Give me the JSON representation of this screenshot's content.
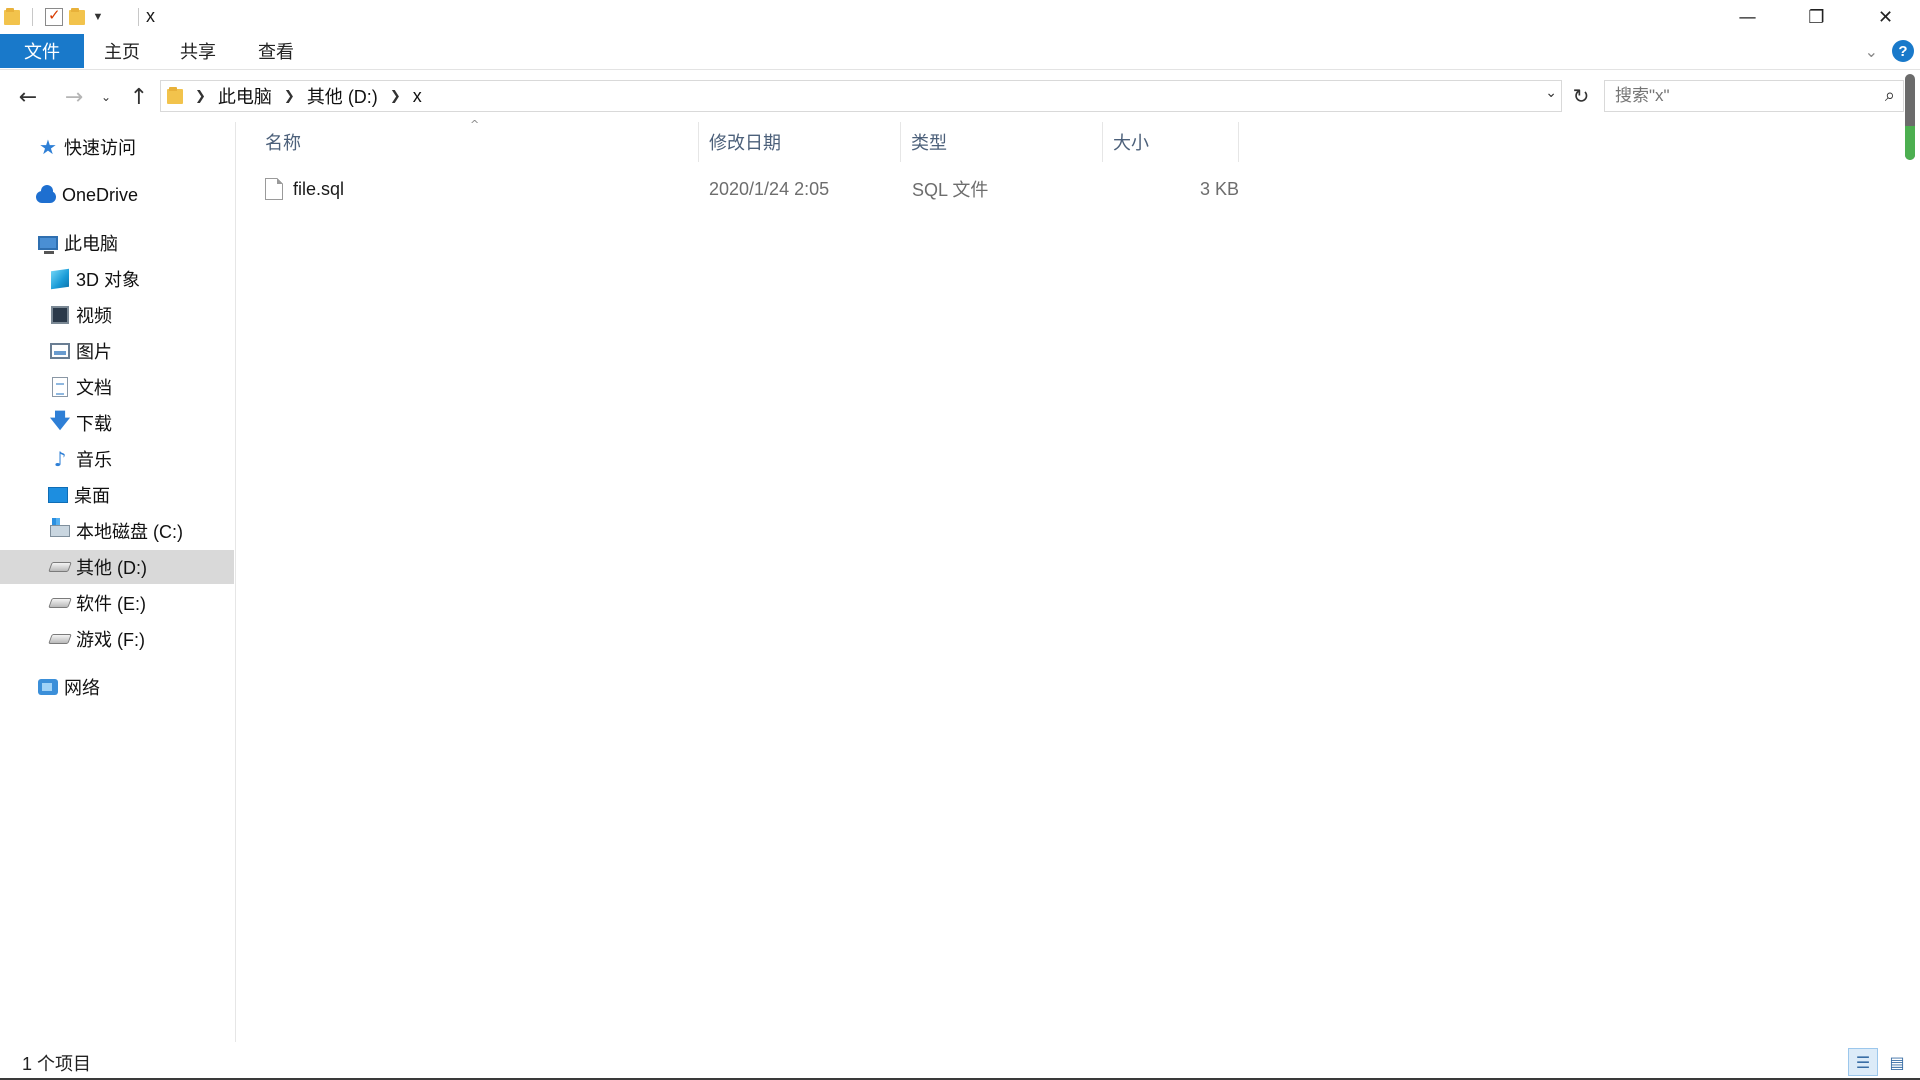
{
  "window": {
    "title": "x",
    "controls": {
      "minimize_icon": "minimize-icon",
      "maximize_icon": "restore-icon",
      "close_icon": "close-icon"
    }
  },
  "ribbon": {
    "tabs": [
      {
        "label": "文件",
        "active": true
      },
      {
        "label": "主页"
      },
      {
        "label": "共享"
      },
      {
        "label": "查看"
      }
    ],
    "accent": "#1979ca"
  },
  "address": {
    "crumbs": [
      "此电脑",
      "其他 (D:)",
      "x"
    ]
  },
  "search": {
    "placeholder": "搜索\"x\""
  },
  "sidebar": {
    "items": [
      {
        "label": "快速访问",
        "icon": "star-icon"
      },
      {
        "label": "OneDrive",
        "icon": "cloud-icon"
      },
      {
        "label": "此电脑",
        "icon": "computer-icon"
      },
      {
        "label": "3D 对象",
        "icon": "cube-icon"
      },
      {
        "label": "视频",
        "icon": "video-icon"
      },
      {
        "label": "图片",
        "icon": "picture-icon"
      },
      {
        "label": "文档",
        "icon": "document-icon"
      },
      {
        "label": "下载",
        "icon": "download-icon"
      },
      {
        "label": "音乐",
        "icon": "music-icon"
      },
      {
        "label": "桌面",
        "icon": "desktop-icon"
      },
      {
        "label": "本地磁盘 (C:)",
        "icon": "system-drive-icon"
      },
      {
        "label": "其他 (D:)",
        "icon": "drive-icon",
        "selected": true
      },
      {
        "label": "软件 (E:)",
        "icon": "drive-icon"
      },
      {
        "label": "游戏 (F:)",
        "icon": "drive-icon"
      },
      {
        "label": "网络",
        "icon": "network-icon"
      }
    ]
  },
  "columns": [
    "名称",
    "修改日期",
    "类型",
    "大小"
  ],
  "files": [
    {
      "name": "file.sql",
      "modified": "2020/1/24 2:05",
      "type": "SQL 文件",
      "size": "3 KB",
      "icon": "file-icon"
    }
  ],
  "status": {
    "item_count": "1 个项目"
  }
}
